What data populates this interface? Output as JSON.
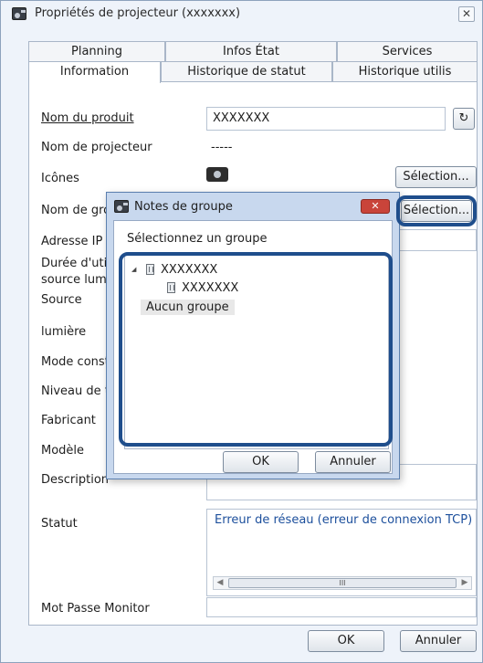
{
  "window": {
    "title": "Propriétés de projecteur (xxxxxxx)",
    "close": "✕"
  },
  "tabs_back": [
    {
      "label": "Planning"
    },
    {
      "label": "Infos État"
    },
    {
      "label": "Services"
    }
  ],
  "tabs_front": [
    {
      "label": "Information",
      "active": true
    },
    {
      "label": "Historique de statut"
    },
    {
      "label": "Historique utilis"
    }
  ],
  "form": {
    "product_name_label": "Nom du produit",
    "product_name_value": "XXXXXXX",
    "projector_name_label": "Nom de projecteur",
    "projector_name_value": "-----",
    "icons_label": "Icônes",
    "icons_select": "Sélection...",
    "group_name_label": "Nom de gro",
    "group_select": "Sélection...",
    "ip_label": "Adresse IP",
    "usage_label_1": "Durée d'uti",
    "usage_label_2": "source lum",
    "source_label": "Source",
    "light_label": "lumière",
    "mode_label": "Mode const",
    "level_label": "Niveau de t",
    "maker_label": "Fabricant",
    "model_label": "Modèle",
    "description_label": "Description",
    "status_label": "Statut",
    "status_value": "Erreur de réseau (erreur de connexion TCP)",
    "monitor_pwd_label": "Mot Passe Monitor",
    "scroll_thumb": "III"
  },
  "footer": {
    "ok": "OK",
    "cancel": "Annuler"
  },
  "modal": {
    "title": "Notes de groupe",
    "close": "✕",
    "prompt": "Sélectionnez un groupe",
    "tree": [
      {
        "label": "XXXXXXX",
        "expander": "◢"
      },
      {
        "label": "XXXXXXX"
      }
    ],
    "none_group": "Aucun groupe",
    "ok": "OK",
    "cancel": "Annuler"
  },
  "colors": {
    "highlight": "#1f4e8c",
    "modal_close": "#c9443a",
    "status_text": "#1c4f9c"
  }
}
